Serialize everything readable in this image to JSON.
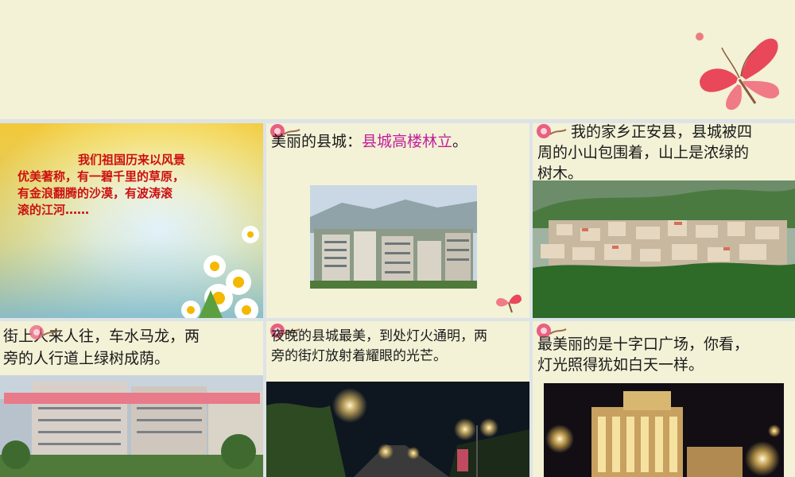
{
  "slide": {
    "panel1": {
      "text": "我们祖国历来以风景优美著称，有一碧千里的草原，有金浪翻腾的沙漠，有波涛滚滚的江河……",
      "lines": [
        "我们祖国历来以风景",
        "优美著称，有一碧千里的草原，",
        "有金浪翻腾的沙漠，有波涛滚",
        "滚的江河……"
      ]
    },
    "panel2": {
      "caption_prefix": "美丽的县城：",
      "caption_highlight": "县城高楼林立",
      "caption_suffix": "。"
    },
    "panel3": {
      "lines": [
        "我的家乡正安县，县城被四",
        "周的小山包围着，山上是浓绿的",
        "树木。"
      ]
    },
    "panel4": {
      "lines": [
        "街上人来人往，车水马龙，两",
        "旁的人行道上绿树成荫。"
      ]
    },
    "panel5": {
      "lines": [
        "夜晚的县城最美，到处灯火通明，两",
        "旁的街灯放射着耀眼的光芒。"
      ]
    },
    "panel6": {
      "lines": [
        "最美丽的是十字口广场，你看，",
        "灯光照得犹如白天一样。"
      ]
    }
  },
  "colors": {
    "background": "#f1efcf",
    "panel": "#f3f1d6",
    "red_text": "#cc1010",
    "highlight": "#c0209a",
    "butterfly": "#e8485a"
  },
  "icons": [
    "butterfly-icon",
    "flower-icon"
  ]
}
